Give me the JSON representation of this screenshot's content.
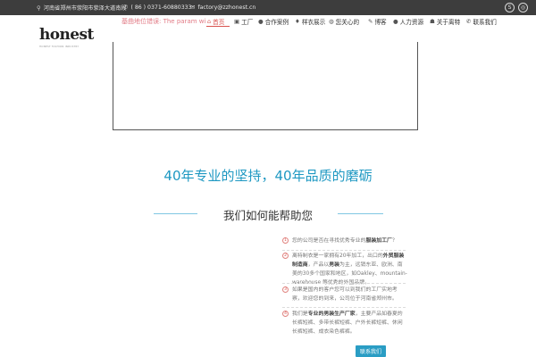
{
  "topbar": {
    "address": "河南省郑州市荥阳市荥泽大道南段",
    "phone": "( 86 ) 0371-60880333",
    "email": "factory@zzhonest.cn"
  },
  "logo": {
    "main": "honest",
    "sub": "HONEST FASHION INDUSTRY"
  },
  "map_error": "基曲地位错误: The param wi",
  "nav": {
    "home": "首页",
    "factory": "工厂",
    "cases": "合作案例",
    "samples": "样衣展示",
    "concern": "您关心的",
    "blog": "博客",
    "hr": "人力资源",
    "about": "关于离特",
    "contact": "联系我们"
  },
  "slogan": "40年专业的坚持，40年品质的磨砺",
  "subhead": "我们如何能帮助您",
  "qa": [
    {
      "num": "1",
      "parts": [
        "您的公司是否在寻找优秀专业的",
        "服装加工厂",
        "？"
      ]
    },
    {
      "num": "2",
      "parts": [
        "离特制衣是一家拥有20年加工，出口的",
        "外贸服装制造商",
        "，产品以",
        "男装",
        "为主，远销东亚、欧洲、南美的30多个国家和地区，如Oakley、mountain-warehouse 等优秀的外国品牌。"
      ]
    },
    {
      "num": "3",
      "parts": [
        "如果是国内的客户您可以到我们的工厂实地考察，欢迎您的到来，公司位于河南省郑州市。"
      ]
    },
    {
      "num": "4",
      "parts": [
        "我们是",
        "专业的男装生产厂家",
        "，主要产品如春夏的长裤短裤、多带长裤短裤、户外长裤短裤、休闲长裤短裤、成衣染色裤裤。"
      ]
    }
  ],
  "contact_button": "联系我们",
  "colors": {
    "accent": "#2a9dc4",
    "nav_active": "#d9534f",
    "topbar": "#3d3d3d"
  }
}
